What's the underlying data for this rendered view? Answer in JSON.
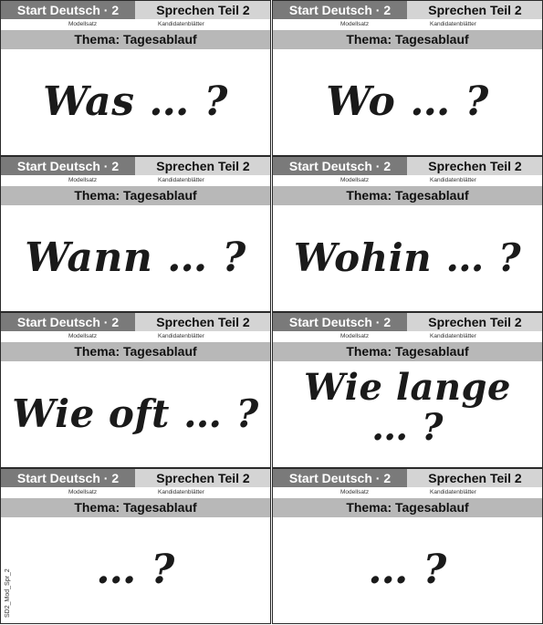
{
  "common": {
    "brand": "Start Deutsch · 2",
    "part": "Sprechen Teil 2",
    "meta_left": "Modellsatz",
    "meta_right": "Kandidatenblätter",
    "topic": "Thema: Tagesablauf"
  },
  "cards": [
    {
      "question": "Was … ?"
    },
    {
      "question": "Wo … ?"
    },
    {
      "question": "Wann … ?"
    },
    {
      "question": "Wohin … ?"
    },
    {
      "question": "Wie oft … ?"
    },
    {
      "question": "Wie lange\n… ?"
    },
    {
      "question": "… ?"
    },
    {
      "question": "… ?"
    }
  ],
  "side_code": "SD2_Mod_Spr_2"
}
